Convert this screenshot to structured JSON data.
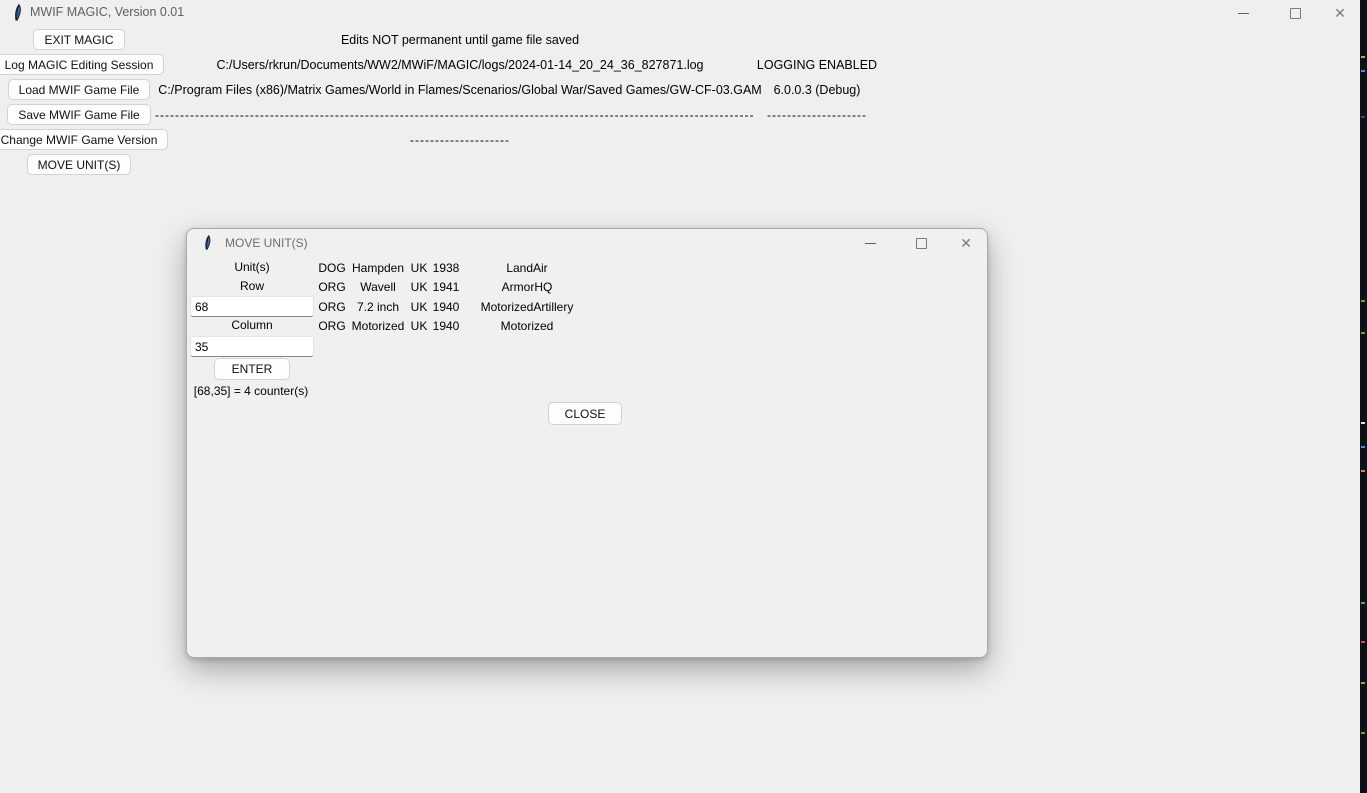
{
  "window": {
    "title": "MWIF MAGIC, Version 0.01",
    "controls": {
      "minimize": "—",
      "maximize": "□",
      "close": "✕"
    }
  },
  "sidebar_buttons": [
    "EXIT MAGIC",
    "Log MAGIC Editing Session",
    "Load MWIF Game File",
    "Save MWIF Game File",
    "Change MWIF Game Version",
    "MOVE UNIT(S)"
  ],
  "status": {
    "edits_note": "Edits NOT permanent until game file saved",
    "log_path": "C:/Users/rkrun/Documents/WW2/MWiF/MAGIC/logs/2024-01-14_20_24_36_827871.log",
    "logging_status": "LOGGING ENABLED",
    "game_path": "C:/Program Files (x86)/Matrix Games/World in Flames/Scenarios/Global War/Saved Games/GW-CF-03.GAM",
    "version": "6.0.0.3 (Debug)",
    "divider_long": "------------------------------------------------------------------------------------------------------------------------",
    "divider_short": "--------------------"
  },
  "move_units_dialog": {
    "title": "MOVE UNIT(S)",
    "controls": {
      "minimize": "—",
      "maximize": "□",
      "close": "✕"
    },
    "labels": {
      "units": "Unit(s)",
      "row": "Row",
      "column": "Column"
    },
    "row_value": "68",
    "column_value": "35",
    "enter_label": "ENTER",
    "result_text": "[68,35] = 4 counter(s)",
    "close_label": "CLOSE",
    "units_table": {
      "rows": [
        {
          "org": "DOG",
          "name": "Hampden",
          "country": "UK",
          "year": "1938",
          "type": "LandAir"
        },
        {
          "org": "ORG",
          "name": "Wavell",
          "country": "UK",
          "year": "1941",
          "type": "ArmorHQ"
        },
        {
          "org": "ORG",
          "name": "7.2 inch",
          "country": "UK",
          "year": "1940",
          "type": "MotorizedArtillery"
        },
        {
          "org": "ORG",
          "name": "Motorized",
          "country": "UK",
          "year": "1940",
          "type": "Motorized"
        }
      ]
    }
  },
  "accent_colors": {
    "window_bg": "#efefef",
    "button_bg": "#fdfdfd",
    "button_border": "#d2d2d2",
    "title_text": "#5f5f5f",
    "background_sliver": "#0d1016"
  }
}
